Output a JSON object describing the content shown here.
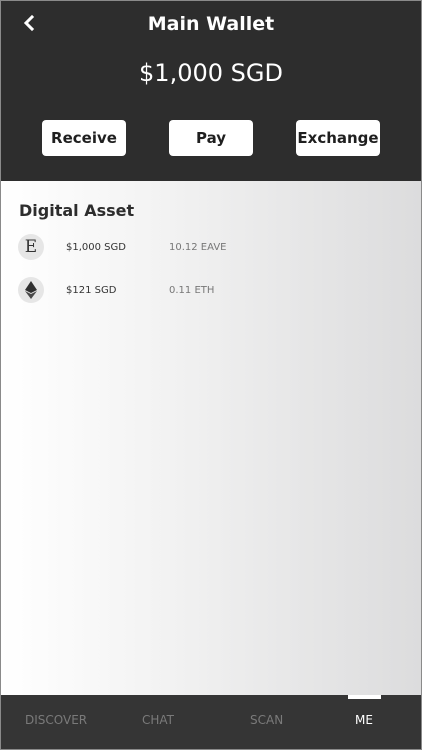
{
  "header": {
    "title": "Main Wallet",
    "balance": "$1,000 SGD",
    "back_icon": "chevron-left-icon"
  },
  "actions": {
    "receive_label": "Receive",
    "pay_label": "Pay",
    "exchange_label": "Exchange"
  },
  "assets": {
    "section_title": "Digital Asset",
    "items": [
      {
        "icon": "eave-icon",
        "glyph": "E",
        "fiat": "$1,000 SGD",
        "crypto": "10.12 EAVE"
      },
      {
        "icon": "ethereum-icon",
        "fiat": "$121 SGD",
        "crypto": "0.11 ETH"
      }
    ]
  },
  "nav": {
    "items": [
      {
        "label": "DISCOVER"
      },
      {
        "label": "CHAT"
      },
      {
        "label": "SCAN"
      },
      {
        "label": "ME",
        "active": true
      }
    ]
  },
  "colors": {
    "header_bg": "#2d2d2d",
    "nav_bg": "#353535",
    "nav_inactive": "#7a7a7a",
    "nav_active": "#ffffff"
  }
}
